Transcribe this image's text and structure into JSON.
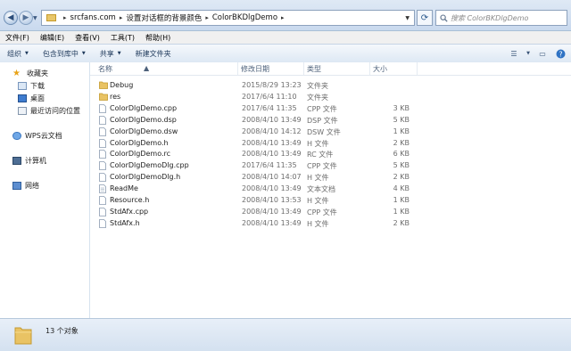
{
  "address": {
    "crumbs": [
      "srcfans.com",
      "设置对话框的背景颜色",
      "ColorBKDlgDemo"
    ],
    "search_placeholder": "搜索 ColorBKDlgDemo"
  },
  "menu": [
    "文件(F)",
    "编辑(E)",
    "查看(V)",
    "工具(T)",
    "帮助(H)"
  ],
  "toolbar": {
    "organize": "组织",
    "include": "包含到库中",
    "share": "共享",
    "new_folder": "新建文件夹"
  },
  "sidebar": {
    "favorites": "收藏夹",
    "downloads": "下载",
    "desktop": "桌面",
    "recent": "最近访问的位置",
    "wps": "WPS云文档",
    "computer": "计算机",
    "network": "网络"
  },
  "columns": {
    "name": "名称",
    "date": "修改日期",
    "type": "类型",
    "size": "大小"
  },
  "files": [
    {
      "name": "Debug",
      "date": "2015/8/29 13:23",
      "type": "文件夹",
      "size": "",
      "icon": "folder-icon"
    },
    {
      "name": "res",
      "date": "2017/6/4 11:10",
      "type": "文件夹",
      "size": "",
      "icon": "folder-icon"
    },
    {
      "name": "ColorDlgDemo.cpp",
      "date": "2017/6/4 11:35",
      "type": "CPP 文件",
      "size": "3 KB",
      "icon": "file-icon"
    },
    {
      "name": "ColorDlgDemo.dsp",
      "date": "2008/4/10 13:49",
      "type": "DSP 文件",
      "size": "5 KB",
      "icon": "file-icon"
    },
    {
      "name": "ColorDlgDemo.dsw",
      "date": "2008/4/10 14:12",
      "type": "DSW 文件",
      "size": "1 KB",
      "icon": "file-icon"
    },
    {
      "name": "ColorDlgDemo.h",
      "date": "2008/4/10 13:49",
      "type": "H 文件",
      "size": "2 KB",
      "icon": "file-icon"
    },
    {
      "name": "ColorDlgDemo.rc",
      "date": "2008/4/10 13:49",
      "type": "RC 文件",
      "size": "6 KB",
      "icon": "file-icon"
    },
    {
      "name": "ColorDlgDemoDlg.cpp",
      "date": "2017/6/4 11:35",
      "type": "CPP 文件",
      "size": "5 KB",
      "icon": "file-icon"
    },
    {
      "name": "ColorDlgDemoDlg.h",
      "date": "2008/4/10 14:07",
      "type": "H 文件",
      "size": "2 KB",
      "icon": "file-icon"
    },
    {
      "name": "ReadMe",
      "date": "2008/4/10 13:49",
      "type": "文本文档",
      "size": "4 KB",
      "icon": "text-file-icon"
    },
    {
      "name": "Resource.h",
      "date": "2008/4/10 13:53",
      "type": "H 文件",
      "size": "1 KB",
      "icon": "file-icon"
    },
    {
      "name": "StdAfx.cpp",
      "date": "2008/4/10 13:49",
      "type": "CPP 文件",
      "size": "1 KB",
      "icon": "file-icon"
    },
    {
      "name": "StdAfx.h",
      "date": "2008/4/10 13:49",
      "type": "H 文件",
      "size": "2 KB",
      "icon": "file-icon"
    }
  ],
  "status": {
    "count": "13 个对象"
  }
}
